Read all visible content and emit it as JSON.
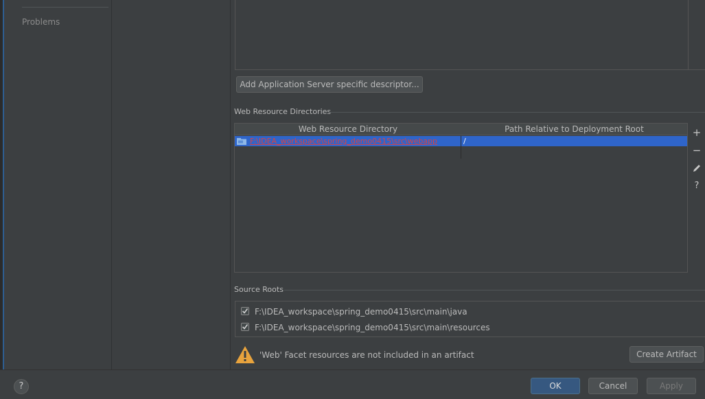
{
  "nav": {
    "problems_label": "Problems"
  },
  "descriptor": {
    "add_button_label": "Add Application Server specific descriptor..."
  },
  "web_resources": {
    "section_title": "Web Resource Directories",
    "columns": [
      "Web Resource Directory",
      "Path Relative to Deployment Root"
    ],
    "rows": [
      {
        "directory": "F:\\IDEA_workspace\\spring_demo0415\\src\\webapp",
        "path": "/"
      }
    ],
    "tools": {
      "add": "+",
      "remove": "−",
      "help": "?"
    }
  },
  "source_roots": {
    "section_title": "Source Roots",
    "items": [
      {
        "label": "F:\\IDEA_workspace\\spring_demo0415\\src\\main\\java",
        "checked": true
      },
      {
        "label": "F:\\IDEA_workspace\\spring_demo0415\\src\\main\\resources",
        "checked": true
      }
    ]
  },
  "warning": {
    "text": "'Web' Facet resources are not included in an artifact",
    "action_label": "Create Artifact"
  },
  "footer": {
    "help": "?",
    "ok": "OK",
    "cancel": "Cancel",
    "apply": "Apply"
  },
  "colors": {
    "selection": "#2f65ca",
    "warning": "#e8a33d",
    "ok_button": "#365880",
    "error_text": "#d64444"
  }
}
